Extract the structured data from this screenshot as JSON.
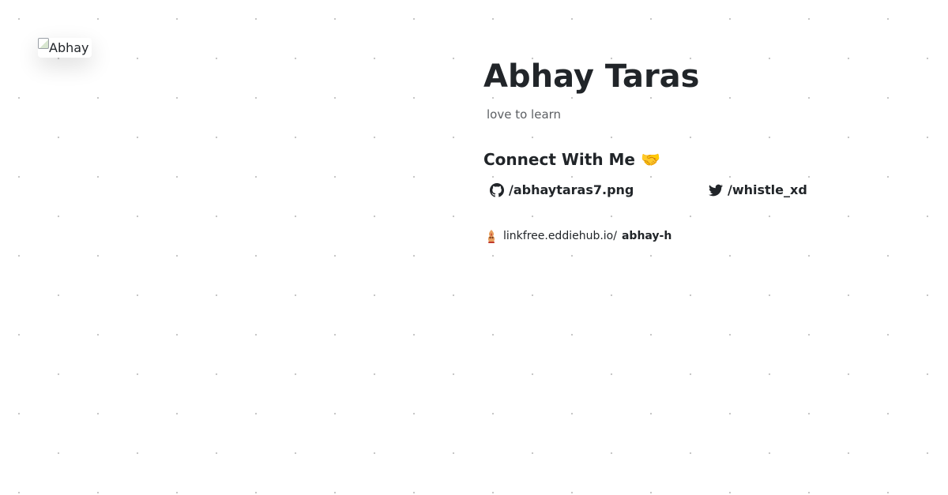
{
  "profile": {
    "avatar_alt": "Abhay",
    "name": "Abhay Taras",
    "bio": "love to learn"
  },
  "connect": {
    "heading": "Connect With Me 🤝"
  },
  "socials": [
    {
      "icon": "github-icon",
      "label": "/abhaytaras7.png"
    },
    {
      "icon": "twitter-icon",
      "label": "/whistle_xd"
    }
  ],
  "footer": {
    "icon": "linkfree-logo-icon",
    "domain": "linkfree.eddiehub.io/",
    "username": "abhay-h"
  },
  "colors": {
    "text": "#212529",
    "muted": "#5c5f63",
    "dots": "#c4c4c4"
  }
}
